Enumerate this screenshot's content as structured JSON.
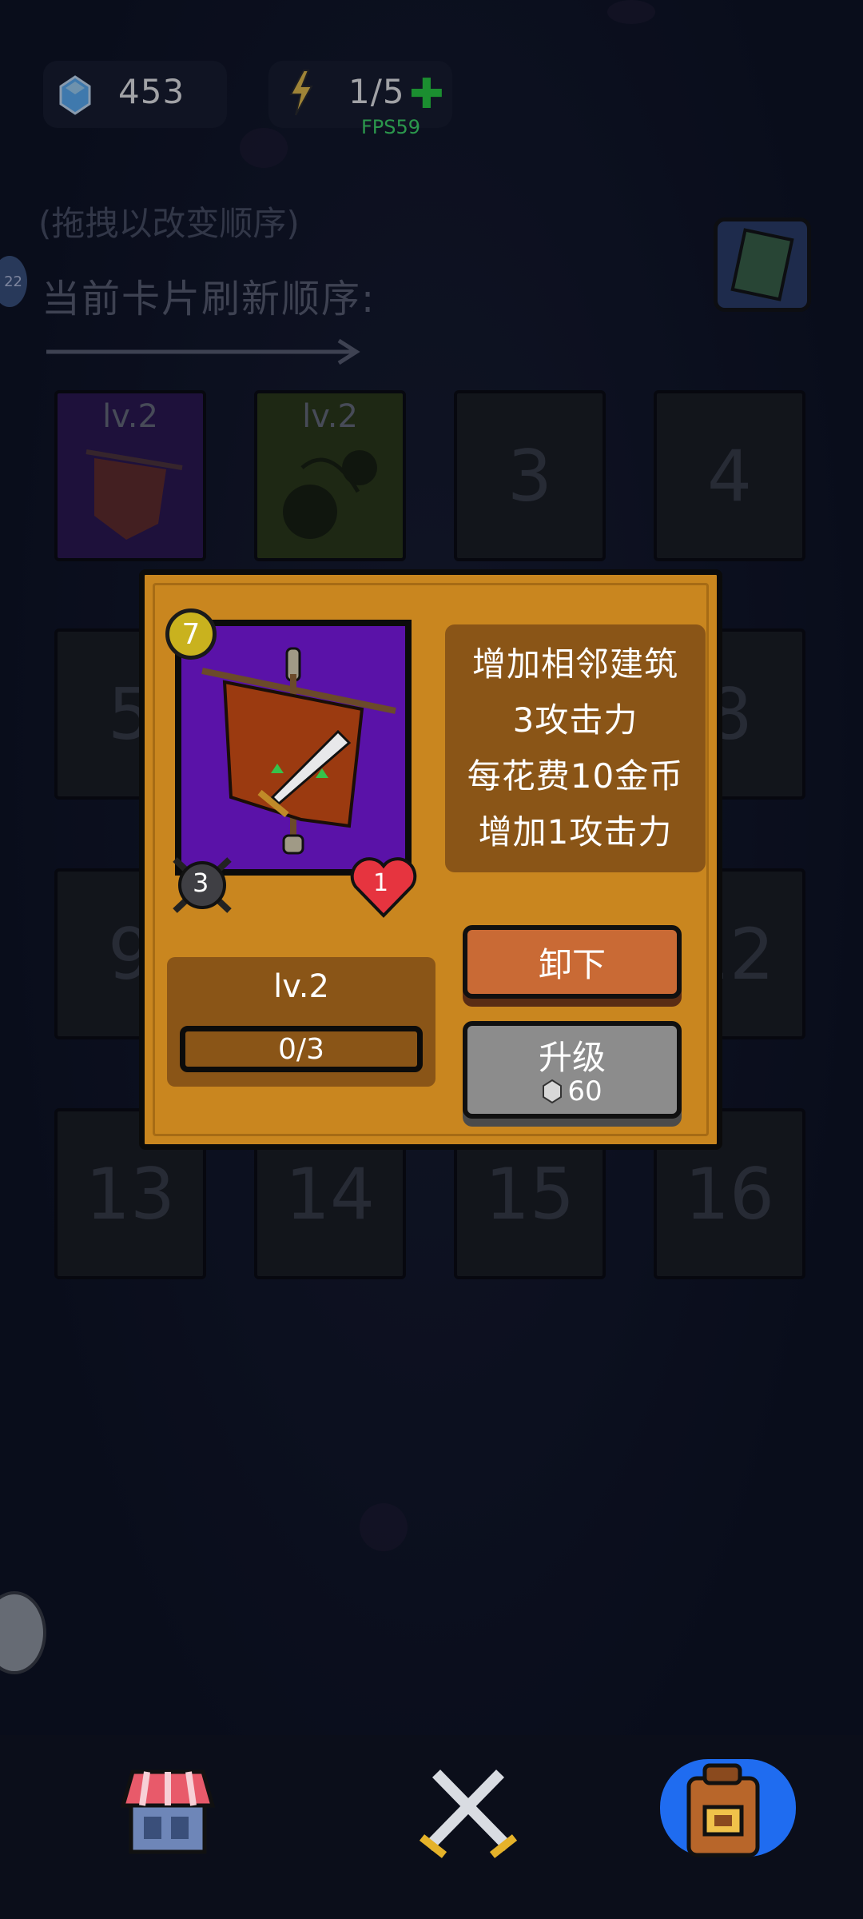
{
  "topbar": {
    "gems": "453",
    "energy": "1/5",
    "fps": "FPS59"
  },
  "hint": "(拖拽以改变顺序)",
  "section_title": "当前卡片刷新顺序:",
  "side_badge": "22",
  "slots": [
    {
      "label": "",
      "level": "lv.2",
      "style": "purple"
    },
    {
      "label": "",
      "level": "lv.2",
      "style": "olive"
    },
    {
      "label": "3"
    },
    {
      "label": "4"
    },
    {
      "label": "5"
    },
    {
      "label": "8"
    },
    {
      "label": "9"
    },
    {
      "label": "12"
    },
    {
      "label": "13"
    },
    {
      "label": "14"
    },
    {
      "label": "15"
    },
    {
      "label": "16"
    }
  ],
  "popup": {
    "cost": "7",
    "attack": "3",
    "hp": "1",
    "description": [
      "增加相邻建筑",
      "3攻击力",
      "每花费10金币",
      "增加1攻击力"
    ],
    "level": "lv.2",
    "progress": "0/3",
    "progress_fraction": 0,
    "unequip_label": "卸下",
    "upgrade_label": "升级",
    "upgrade_cost": "60"
  },
  "colors": {
    "popup": "#c9861f",
    "card_bg": "#5a12a8",
    "unequip": "#c96a35",
    "upgrade": "#8c8c8c"
  },
  "nav": {
    "icons": [
      "shop-icon",
      "battle-icon",
      "backpack-icon"
    ],
    "active": "backpack-icon"
  }
}
